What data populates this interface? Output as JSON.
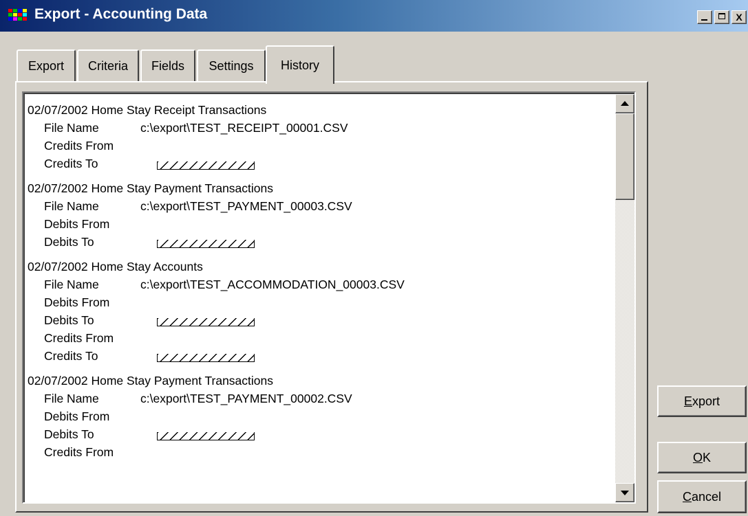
{
  "window": {
    "title": "Export - Accounting Data",
    "icon": "app-grid-icon",
    "controls": [
      "minimize",
      "maximize",
      "close"
    ],
    "close_glyph": "X"
  },
  "tabs": [
    {
      "label": "Export",
      "active": false
    },
    {
      "label": "Criteria",
      "active": false
    },
    {
      "label": "Fields",
      "active": false
    },
    {
      "label": "Settings",
      "active": false
    },
    {
      "label": "History",
      "active": true
    }
  ],
  "history": [
    {
      "heading": "02/07/2002  Home Stay Receipt Transactions",
      "rows": [
        {
          "label": "File Name",
          "value": "c:\\export\\TEST_RECEIPT_00001.CSV",
          "hatched": false
        },
        {
          "label": "Credits From",
          "value": "",
          "hatched": false
        },
        {
          "label": "Credits To",
          "value": "",
          "hatched": true
        }
      ]
    },
    {
      "heading": "02/07/2002  Home Stay Payment Transactions",
      "rows": [
        {
          "label": "File Name",
          "value": "c:\\export\\TEST_PAYMENT_00003.CSV",
          "hatched": false
        },
        {
          "label": "Debits From",
          "value": "",
          "hatched": false
        },
        {
          "label": "Debits To",
          "value": "",
          "hatched": true
        }
      ]
    },
    {
      "heading": "02/07/2002  Home Stay Accounts",
      "rows": [
        {
          "label": "File Name",
          "value": "c:\\export\\TEST_ACCOMMODATION_00003.CSV",
          "hatched": false
        },
        {
          "label": "Debits From",
          "value": "",
          "hatched": false
        },
        {
          "label": "Debits To",
          "value": "",
          "hatched": true
        },
        {
          "label": "Credits From",
          "value": "",
          "hatched": false
        },
        {
          "label": "Credits To",
          "value": "",
          "hatched": true
        }
      ]
    },
    {
      "heading": "02/07/2002  Home Stay Payment Transactions",
      "rows": [
        {
          "label": "File Name",
          "value": "c:\\export\\TEST_PAYMENT_00002.CSV",
          "hatched": false
        },
        {
          "label": "Debits From",
          "value": "",
          "hatched": false
        },
        {
          "label": "Debits To",
          "value": "",
          "hatched": true
        },
        {
          "label": "Credits From",
          "value": "",
          "hatched": false
        }
      ]
    }
  ],
  "buttons": {
    "export": {
      "mnemonic": "E",
      "rest": "xport"
    },
    "ok": {
      "mnemonic": "O",
      "rest": "K"
    },
    "cancel": {
      "mnemonic": "C",
      "rest": "ancel"
    }
  },
  "colors": {
    "titlebar_start": "#0a246a",
    "titlebar_end": "#a6caf0",
    "face": "#d4d0c8"
  }
}
